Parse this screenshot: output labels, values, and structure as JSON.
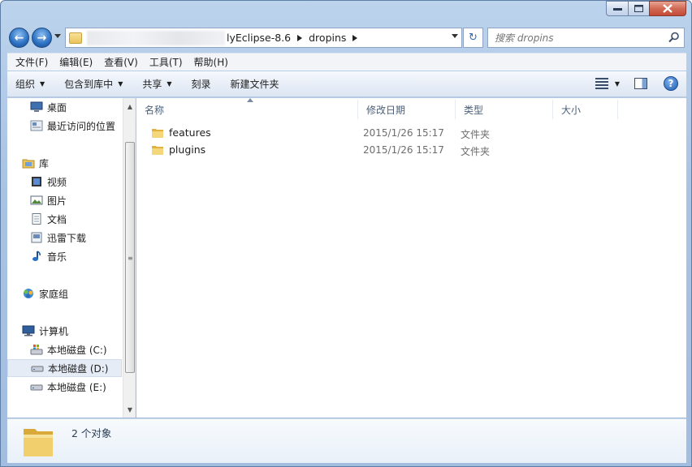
{
  "window": {
    "caption_minimize": "—",
    "caption_maximize": "□",
    "caption_close": "✕"
  },
  "navbar": {
    "back_glyph": "←",
    "forward_glyph": "→",
    "breadcrumb": [
      "lyEclipse-8.6",
      "dropins"
    ],
    "refresh_glyph": "↻",
    "search_placeholder": "搜索 dropins"
  },
  "menu": {
    "items": [
      "文件(F)",
      "编辑(E)",
      "查看(V)",
      "工具(T)",
      "帮助(H)"
    ]
  },
  "command_bar": {
    "organize": "组织",
    "include_in_library": "包含到库中",
    "share": "共享",
    "burn": "刻录",
    "new_folder": "新建文件夹",
    "help": "?"
  },
  "sidebar": {
    "items": [
      {
        "label": "桌面",
        "icon": "desktop-icon"
      },
      {
        "label": "最近访问的位置",
        "icon": "recent-places-icon"
      },
      {
        "label": "库",
        "icon": "library-icon"
      },
      {
        "label": "视频",
        "icon": "video-icon"
      },
      {
        "label": "图片",
        "icon": "pictures-icon"
      },
      {
        "label": "文档",
        "icon": "documents-icon"
      },
      {
        "label": "迅雷下载",
        "icon": "downloads-icon"
      },
      {
        "label": "音乐",
        "icon": "music-icon"
      },
      {
        "label": "家庭组",
        "icon": "homegroup-icon"
      },
      {
        "label": "计算机",
        "icon": "computer-icon"
      },
      {
        "label": "本地磁盘 (C:)",
        "icon": "drive-icon"
      },
      {
        "label": "本地磁盘 (D:)",
        "icon": "drive-icon",
        "selected": true
      },
      {
        "label": "本地磁盘 (E:)",
        "icon": "drive-icon"
      }
    ]
  },
  "columns": {
    "name": "名称",
    "modified": "修改日期",
    "type": "类型",
    "size": "大小"
  },
  "files": [
    {
      "name": "features",
      "modified": "2015/1/26 15:17",
      "type": "文件夹"
    },
    {
      "name": "plugins",
      "modified": "2015/1/26 15:17",
      "type": "文件夹"
    }
  ],
  "details": {
    "count": "2 个对象"
  },
  "colors": {
    "accent": "#2a6fc0",
    "folder": "#e9c45a",
    "selection": "#e5ecf5"
  }
}
